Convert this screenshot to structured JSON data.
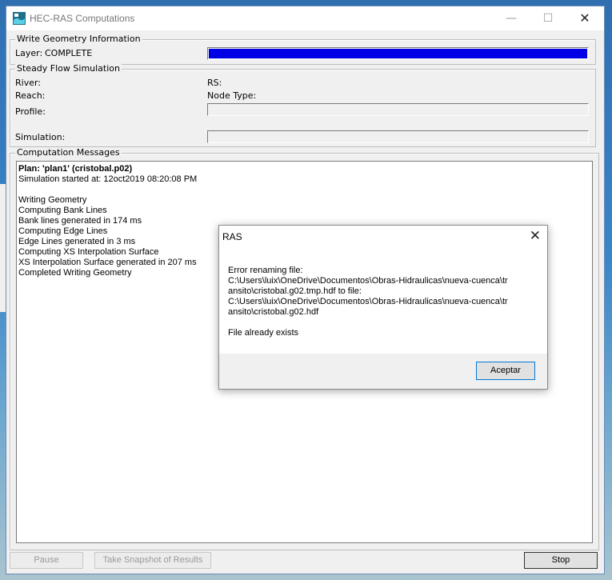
{
  "window": {
    "title": "HEC-RAS Computations",
    "min_glyph": "—",
    "max_glyph": "☐",
    "close_glyph": "✕"
  },
  "write_geometry": {
    "legend": "Write Geometry Information",
    "layer_label": "Layer:",
    "layer_value": "COMPLETE",
    "progress_fraction": 1.0
  },
  "steady_flow": {
    "legend": "Steady Flow Simulation",
    "river_label": "River:",
    "rs_label": "RS:",
    "reach_label": "Reach:",
    "node_type_label": "Node Type:",
    "profile_label": "Profile:",
    "simulation_label": "Simulation:"
  },
  "messages": {
    "legend": "Computation Messages",
    "lines": [
      {
        "text": "Plan: 'plan1' (cristobal.p02)",
        "bold": true
      },
      {
        "text": "Simulation started at: 12oct2019 08:20:08 PM",
        "bold": false
      },
      {
        "text": "",
        "bold": false
      },
      {
        "text": "Writing Geometry",
        "bold": false
      },
      {
        "text": "Computing Bank Lines",
        "bold": false
      },
      {
        "text": "Bank lines generated in 174 ms",
        "bold": false
      },
      {
        "text": "Computing Edge Lines",
        "bold": false
      },
      {
        "text": "Edge Lines generated in 3 ms",
        "bold": false
      },
      {
        "text": "Computing XS Interpolation Surface",
        "bold": false
      },
      {
        "text": "XS Interpolation Surface generated in 207 ms",
        "bold": false
      },
      {
        "text": "Completed Writing Geometry",
        "bold": false
      }
    ]
  },
  "buttons": {
    "pause": "Pause",
    "snapshot": "Take Snapshot of Results",
    "stop": "Stop"
  },
  "dialog": {
    "title": "RAS",
    "close_glyph": "✕",
    "lines": [
      "Error renaming file:",
      "C:\\Users\\luix\\OneDrive\\Documentos\\Obras-Hidraulicas\\nueva-cuenca\\tr",
      "ansito\\cristobal.g02.tmp.hdf to file:",
      "C:\\Users\\luix\\OneDrive\\Documentos\\Obras-Hidraulicas\\nueva-cuenca\\tr",
      "ansito\\cristobal.g02.hdf",
      "",
      "File already exists"
    ],
    "ok_label": "Aceptar"
  },
  "colors": {
    "progress_fill": "#0000e6",
    "dialog_button_border": "#0078d7"
  }
}
